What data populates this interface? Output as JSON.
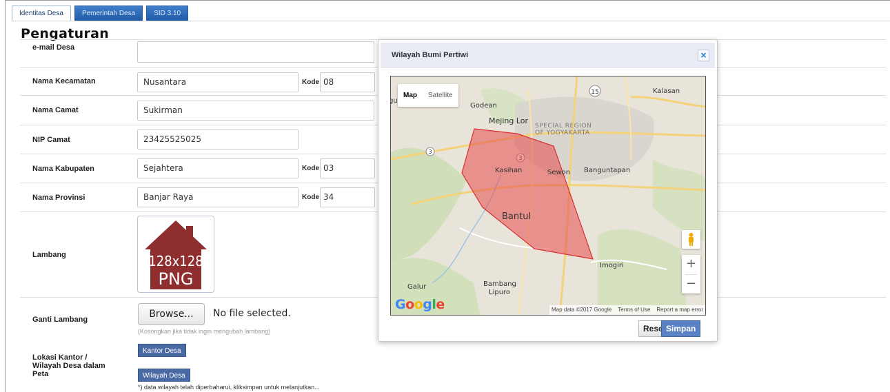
{
  "tabs": [
    {
      "label": "Identitas Desa",
      "active": true
    },
    {
      "label": "Pemerintah Desa",
      "active": false
    },
    {
      "label": "SID 3.10",
      "active": false
    }
  ],
  "page": {
    "title": "Pengaturan"
  },
  "form": {
    "email": {
      "label": "e-mail Desa",
      "value": ""
    },
    "kecamatan": {
      "label": "Nama Kecamatan",
      "value": "Nusantara",
      "kode_label": "Kode",
      "kode": "08"
    },
    "camat": {
      "label": "Nama Camat",
      "value": "Sukirman"
    },
    "nip": {
      "label": "NIP Camat",
      "value": "23425525025"
    },
    "kabupaten": {
      "label": "Nama Kabupaten",
      "value": "Sejahtera",
      "kode_label": "Kode",
      "kode": "03"
    },
    "provinsi": {
      "label": "Nama Provinsi",
      "value": "Banjar Raya",
      "kode_label": "Kode",
      "kode": "34"
    },
    "lambang": {
      "label": "Lambang",
      "image_line1": "128x128",
      "image_line2": "PNG"
    },
    "ganti": {
      "label": "Ganti Lambang",
      "browse": "Browse...",
      "nofile": "No file selected.",
      "hint": "(Kosongkan jika tidak ingin mengubah lambang)"
    },
    "lokasi": {
      "label_line1": "Lokasi Kantor /",
      "label_line2": "Wilayah Desa dalam",
      "label_line3": "Peta",
      "btn_kantor": "Kantor Desa",
      "btn_wilayah": "Wilayah Desa",
      "note": "*) data wilayah telah diperbaharui, kliksimpan untuk melanjutkan..."
    }
  },
  "dialog": {
    "title": "Wilayah Bumi Pertiwi",
    "close": "×",
    "map": {
      "type_map": "Map",
      "type_satellite": "Satellite",
      "labels": {
        "godean": "Godean",
        "mejing": "Mejing Lor",
        "special": "SPECIAL REGION",
        "yogya": "OF YOGYAKARTA",
        "kalasan": "Kalasan",
        "kasihan": "Kasihan",
        "sewon": "Sewon",
        "banguntapan": "Banguntapan",
        "bantul": "Bantul",
        "imogiri": "Imogiri",
        "galur": "Galur",
        "bambang": "Bambang",
        "lipuro": "Lipuro",
        "road15": "15",
        "road3a": "3",
        "road3b": "3",
        "gu": "gu"
      },
      "google": "Google",
      "attribution": {
        "data": "Map data ©2017 Google",
        "terms": "Terms of Use",
        "report": "Report a map error"
      },
      "zoom_in": "+",
      "zoom_out": "−"
    },
    "reset": "Reset",
    "simpan": "Simpan"
  },
  "colors": {
    "polygon_fill": "#e84a4a",
    "tab_blue": "#2e6bbf",
    "button_blue": "#4a6aa3"
  }
}
